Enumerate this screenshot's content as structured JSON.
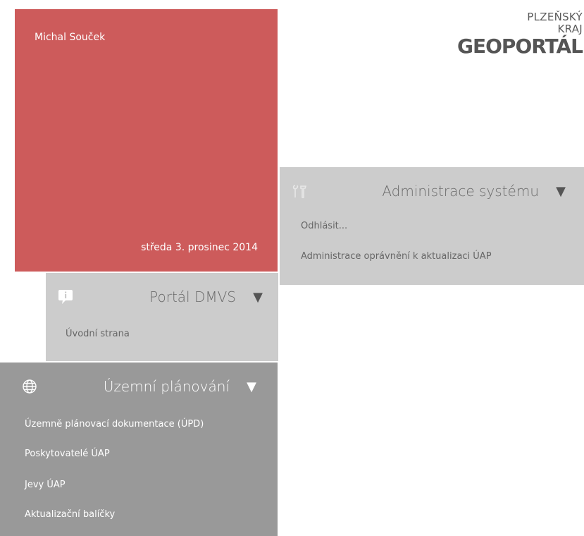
{
  "brand": {
    "line1": "PLZEŇSKÝ",
    "line2": "KRAJ",
    "title": "GEOPORTÁL"
  },
  "user_tile": {
    "user_name": "Michal Souček",
    "date": "středa 3. prosinec 2014",
    "color": "#cd5b5b"
  },
  "admin_panel": {
    "title": "Administrace systému",
    "arrow": "▼",
    "icon": "tools-icon",
    "links": [
      "Odhlásit...",
      "Administrace oprávnění k aktualizaci ÚAP"
    ]
  },
  "portal_panel": {
    "title": "Portál DMVS",
    "arrow": "▼",
    "icon": "info-icon",
    "links": [
      "Úvodní strana"
    ]
  },
  "plan_panel": {
    "title": "Územní plánování",
    "arrow": "▼",
    "icon": "globe-icon",
    "links": [
      "Územně plánovací dokumentace (ÚPD)",
      "Poskytovatelé ÚAP",
      "Jevy ÚAP",
      "Aktualizační balíčky"
    ]
  }
}
